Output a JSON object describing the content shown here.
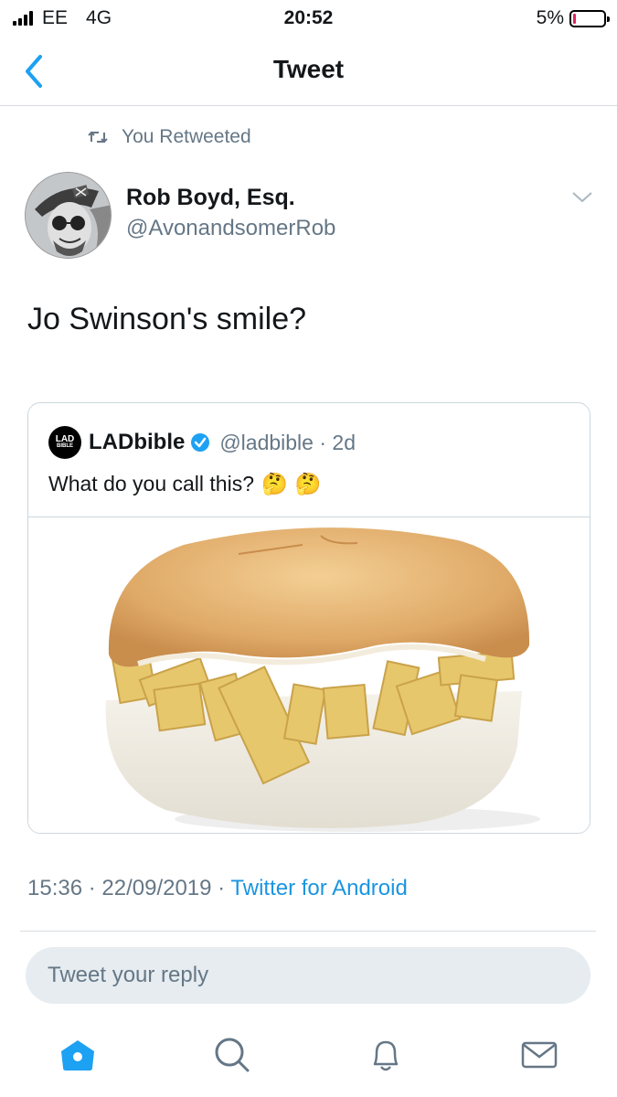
{
  "status_bar": {
    "carrier": "EE",
    "network": "4G",
    "time": "20:52",
    "battery": "5%",
    "battery_level": 0.05
  },
  "header": {
    "title": "Tweet"
  },
  "retweet_context": {
    "label": "You Retweeted"
  },
  "tweet": {
    "author_name": "Rob Boyd, Esq.",
    "author_handle": "@AvonandsomerRob",
    "text": "Jo Swinson's smile?",
    "timestamp": "15:36 · 22/09/2019 · ",
    "source": "Twitter for Android"
  },
  "quoted_tweet": {
    "logo_text_top": "LAD",
    "logo_text_bottom": "BIBLE",
    "author_name": "LADbible",
    "author_handle": "@ladbible · 2d",
    "text": "What do you call this?",
    "emojis": [
      "🤔",
      "🤔"
    ]
  },
  "reply": {
    "placeholder": "Tweet your reply"
  },
  "tabs": [
    "home-icon",
    "search-icon",
    "notifications-icon",
    "messages-icon"
  ],
  "colors": {
    "accent": "#1da1f2",
    "link": "#1b95e0",
    "muted": "#657786",
    "battery_low": "#e0245e"
  }
}
